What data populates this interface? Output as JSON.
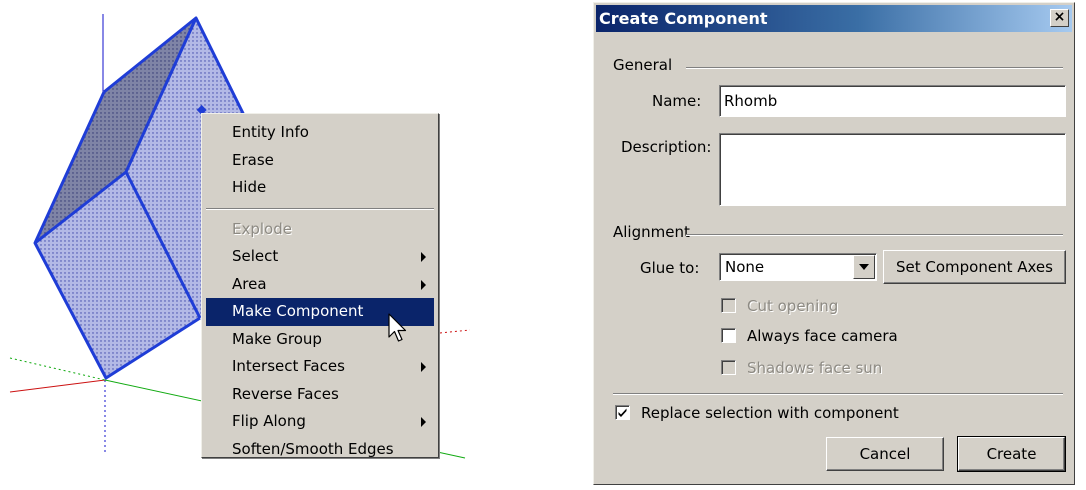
{
  "context_menu": {
    "items": [
      {
        "label": "Entity Info",
        "enabled": true,
        "submenu": false
      },
      {
        "label": "Erase",
        "enabled": true,
        "submenu": false
      },
      {
        "label": "Hide",
        "enabled": true,
        "submenu": false
      },
      {
        "label": "Explode",
        "enabled": false,
        "submenu": false
      },
      {
        "label": "Select",
        "enabled": true,
        "submenu": true
      },
      {
        "label": "Area",
        "enabled": true,
        "submenu": true
      },
      {
        "label": "Make Component",
        "enabled": true,
        "submenu": false,
        "highlighted": true
      },
      {
        "label": "Make Group",
        "enabled": true,
        "submenu": false
      },
      {
        "label": "Intersect Faces",
        "enabled": true,
        "submenu": true
      },
      {
        "label": "Reverse Faces",
        "enabled": true,
        "submenu": false
      },
      {
        "label": "Flip Along",
        "enabled": true,
        "submenu": true
      },
      {
        "label": "Soften/Smooth Edges",
        "enabled": true,
        "submenu": false
      }
    ]
  },
  "dialog": {
    "title": "Create Component",
    "close_label": "×",
    "general": {
      "section_label": "General",
      "name_label": "Name:",
      "name_value": "Rhomb",
      "description_label": "Description:",
      "description_value": ""
    },
    "alignment": {
      "section_label": "Alignment",
      "glue_label": "Glue to:",
      "glue_value": "None",
      "set_axes_label": "Set Component Axes",
      "cut_opening_label": "Cut opening",
      "cut_opening_checked": false,
      "always_face_camera_label": "Always face camera",
      "always_face_camera_checked": false,
      "shadows_face_sun_label": "Shadows face sun",
      "shadows_face_sun_checked": false
    },
    "replace_selection_label": "Replace selection with component",
    "replace_selection_checked": true,
    "cancel_label": "Cancel",
    "create_label": "Create"
  },
  "colors": {
    "selection_blue": "#1f3dd6",
    "face_fill": "#9fa8e0",
    "face_top": "#7d82a8",
    "menu_highlight": "#0a246a",
    "dialog_face": "#d4d0c8",
    "axis_red": "#cc1111",
    "axis_green": "#11aa11",
    "axis_blue": "#1111cc"
  }
}
